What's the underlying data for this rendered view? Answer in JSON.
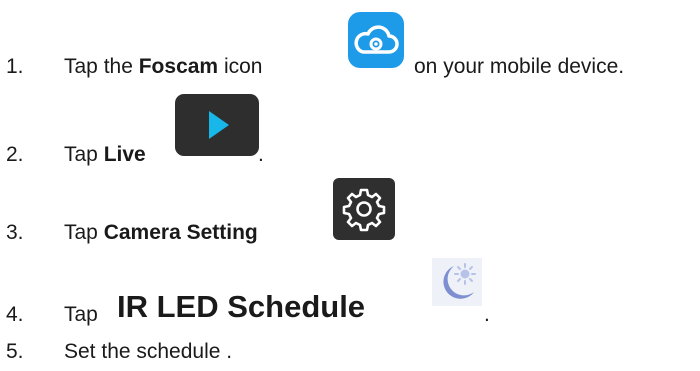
{
  "steps": [
    {
      "number": "1.",
      "prefix": "Tap the ",
      "bold": "Foscam",
      "middle": " icon",
      "suffix": "on your mobile device.",
      "icon": "foscam-cloud-app-icon"
    },
    {
      "number": "2.",
      "prefix": "Tap ",
      "bold": "Live",
      "suffix": ".",
      "icon": "play-icon"
    },
    {
      "number": "3.",
      "prefix": "Tap ",
      "bold": "Camera Setting",
      "icon": "gear-icon"
    },
    {
      "number": "4.",
      "prefix": "Tap ",
      "bold": "IR LED Schedule",
      "suffix": ".",
      "icon": "moon-sun-icon"
    },
    {
      "number": "5.",
      "text": "Set the schedule ."
    }
  ],
  "colors": {
    "foscam_blue": "#1e9be8",
    "play_dark": "#2e2e2e",
    "play_cyan": "#18b7ea",
    "gear_dark": "#2f2f2f",
    "moon_blue": "#7d8fd0"
  }
}
